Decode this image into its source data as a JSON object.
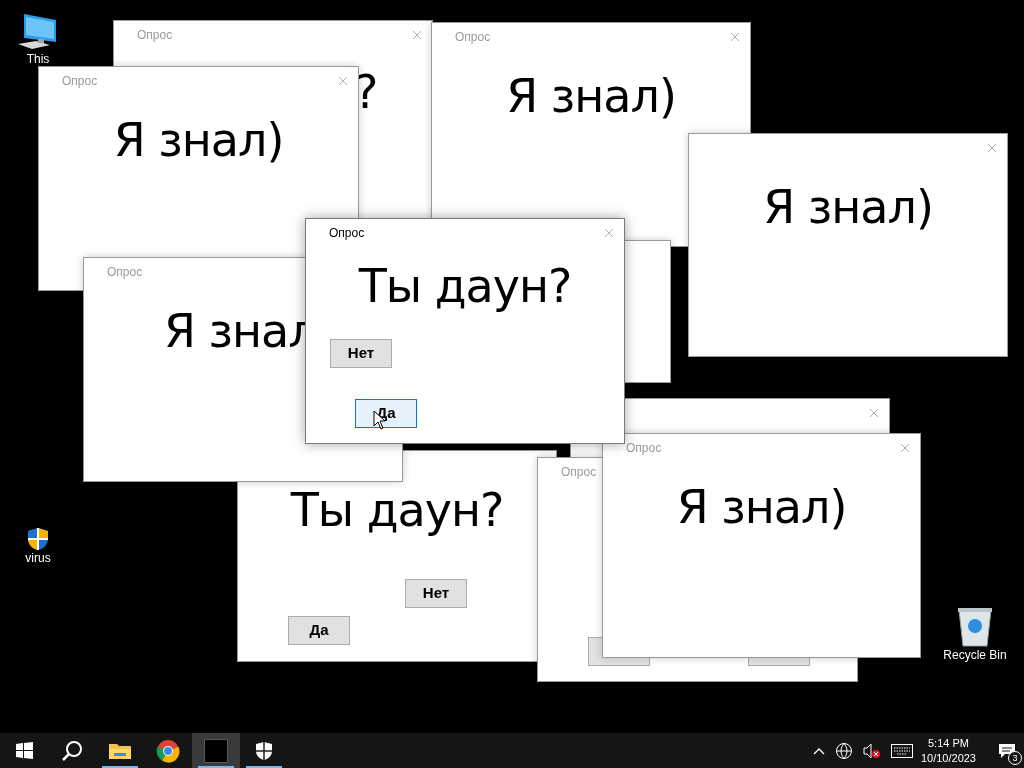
{
  "desktop_icons": [
    {
      "kind": "computer",
      "label": "This"
    },
    {
      "kind": "shield",
      "label": "virus"
    },
    {
      "kind": "bin",
      "label": "Recycle Bin"
    }
  ],
  "windows": [
    {
      "active": false,
      "title": "Опрос",
      "message": "?",
      "close": true
    },
    {
      "active": false,
      "title": "Опрос",
      "message": "Я знал)",
      "close": true
    },
    {
      "active": false,
      "message": "Я знал)",
      "close": true
    },
    {
      "active": false,
      "close": false
    },
    {
      "active": false,
      "title": "Опрос",
      "message": "Я знал)",
      "close": true
    },
    {
      "active": false,
      "message": "Ты даун?",
      "buttons": [
        {
          "label": "Нет",
          "hovered": false
        },
        {
          "label": "Да",
          "hovered": false
        }
      ],
      "close": false
    },
    {
      "active": false,
      "title": "Опрос",
      "message": "Я знал",
      "close": false
    },
    {
      "active": false,
      "close": true
    },
    {
      "active": false,
      "title": "Опрос",
      "buttons": [
        {
          "hovered": false
        },
        {
          "hovered": false
        }
      ],
      "close": false
    },
    {
      "active": false,
      "title": "Опрос",
      "message": "Я знал)",
      "close": true
    },
    {
      "active": true,
      "title": "Опрос",
      "message": "Ты даун?",
      "buttons": [
        {
          "label": "Нет",
          "hovered": false
        },
        {
          "label": "Да",
          "hovered": true
        }
      ],
      "close": true
    }
  ],
  "taskbar": {
    "apps": [
      {
        "kind": "start",
        "running": false
      },
      {
        "kind": "search",
        "running": false
      },
      {
        "kind": "folder",
        "running": true
      },
      {
        "kind": "browser",
        "running": false
      },
      {
        "kind": "window",
        "running": true
      },
      {
        "kind": "shield",
        "running": true
      }
    ],
    "time": "5:14 PM",
    "date": "10/10/2023",
    "notifications": "3"
  }
}
